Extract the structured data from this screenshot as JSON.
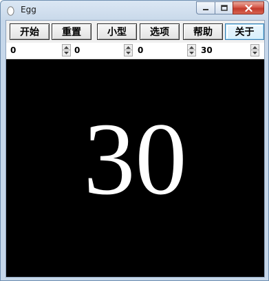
{
  "window": {
    "title": "Egg",
    "icon": "egg-icon"
  },
  "toolbar": {
    "buttons": [
      {
        "label": "开始"
      },
      {
        "label": "重置"
      },
      {
        "label": "小型"
      },
      {
        "label": "选项"
      },
      {
        "label": "帮助"
      },
      {
        "label": "关于"
      }
    ]
  },
  "inputs": [
    {
      "value": "0"
    },
    {
      "value": "0"
    },
    {
      "value": "0"
    },
    {
      "value": "30"
    }
  ],
  "display": {
    "countdown": "30"
  },
  "colors": {
    "canvas_background": "#000000",
    "countdown_text": "#ffffff",
    "close_button": "#c94a3a"
  }
}
